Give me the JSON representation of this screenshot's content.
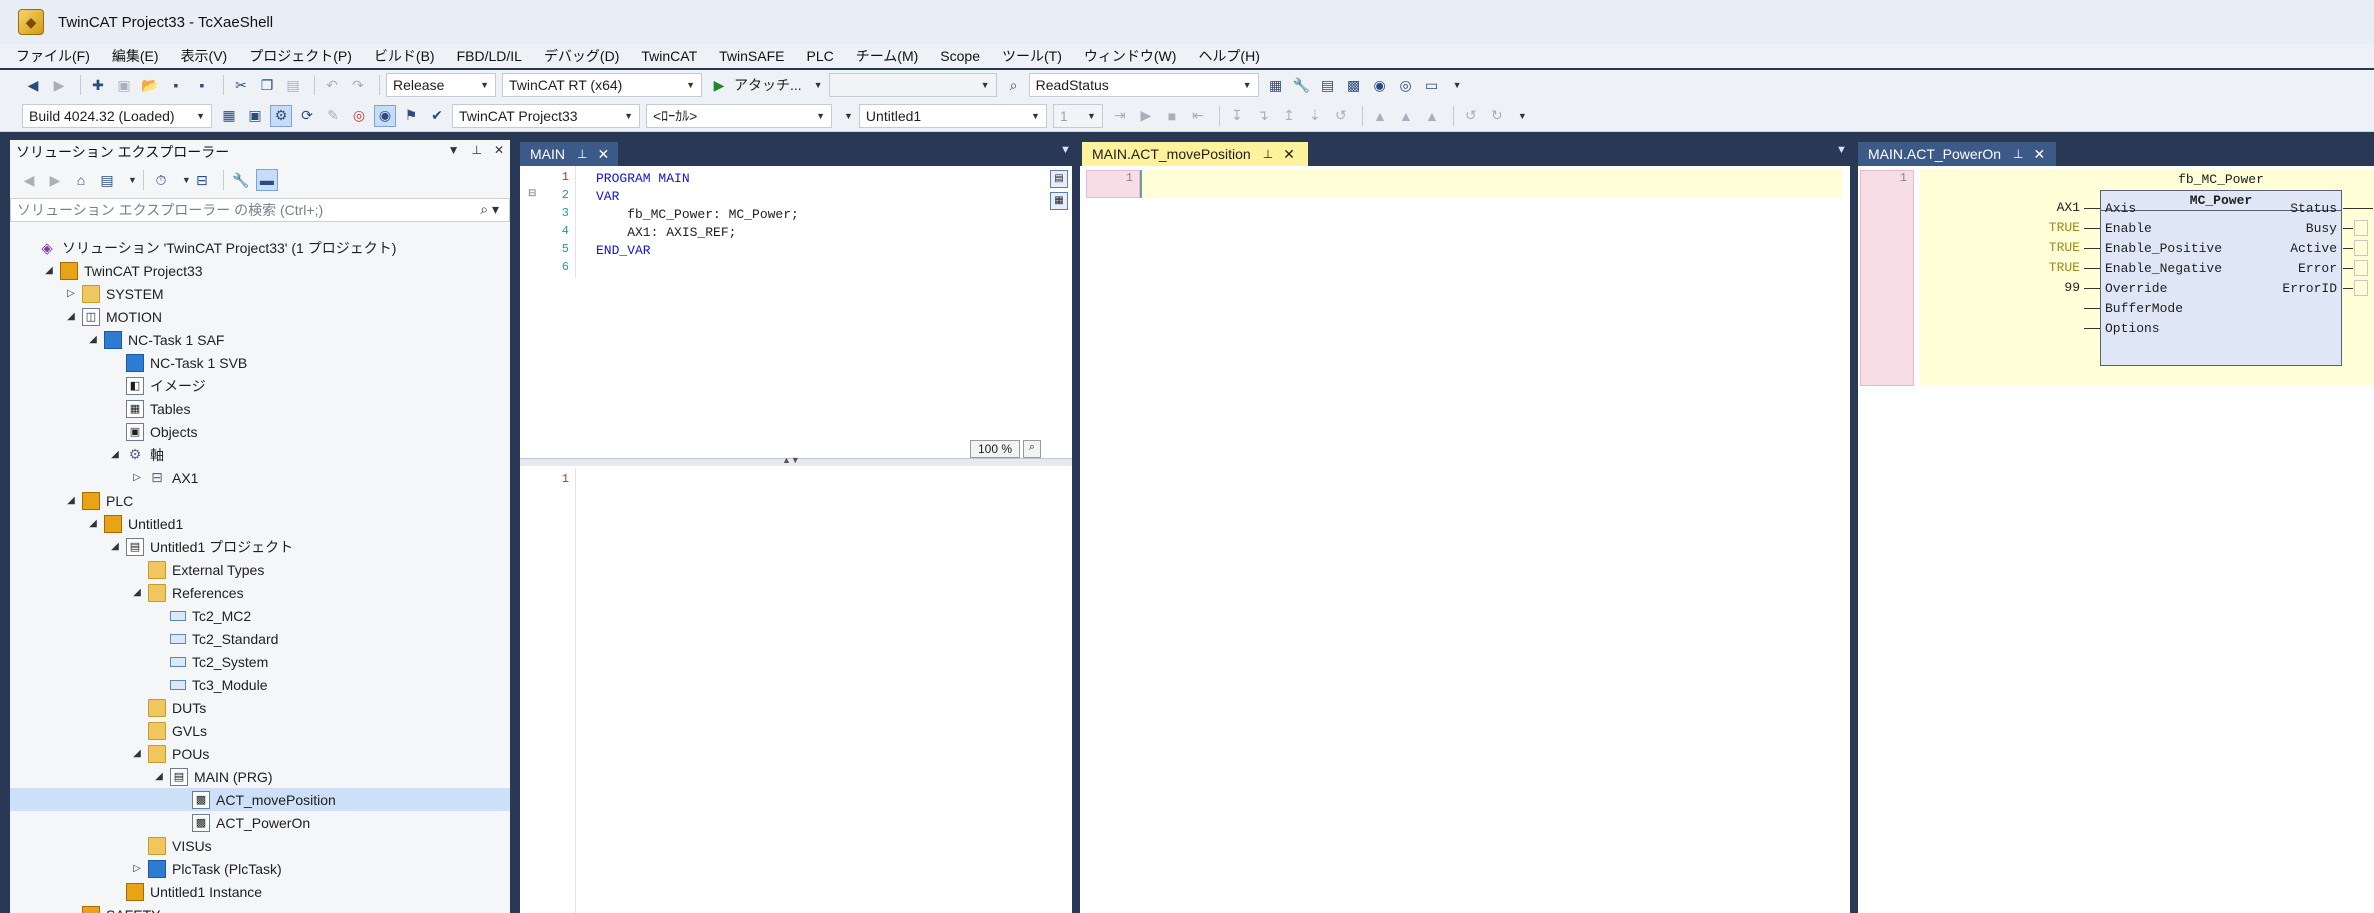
{
  "window": {
    "title": "TwinCAT Project33 - TcXaeShell"
  },
  "menu": [
    "ファイル(F)",
    "編集(E)",
    "表示(V)",
    "プロジェクト(P)",
    "ビルド(B)",
    "FBD/LD/IL",
    "デバッグ(D)",
    "TwinCAT",
    "TwinSAFE",
    "PLC",
    "チーム(M)",
    "Scope",
    "ツール(T)",
    "ウィンドウ(W)",
    "ヘルプ(H)"
  ],
  "toolbar1": {
    "config": "Release",
    "platform": "TwinCAT RT (x64)",
    "attach_label": "アタッチ...",
    "symbol": "ReadStatus"
  },
  "toolbar2": {
    "build": "Build 4024.32 (Loaded)",
    "project": "TwinCAT Project33",
    "target": "<ﾛｰｶﾙ>",
    "plc_project": "Untitled1",
    "task_index": "1"
  },
  "solution_explorer": {
    "title": "ソリューション エクスプローラー",
    "search_placeholder": "ソリューション エクスプローラー の検索 (Ctrl+;)",
    "tree": [
      {
        "label": "ソリューション 'TwinCAT Project33' (1 プロジェクト)",
        "depth": 0,
        "twisty": "",
        "icon": "solution"
      },
      {
        "label": "TwinCAT Project33",
        "depth": 1,
        "twisty": "◢",
        "icon": "project"
      },
      {
        "label": "SYSTEM",
        "depth": 2,
        "twisty": "▷",
        "icon": "system"
      },
      {
        "label": "MOTION",
        "depth": 2,
        "twisty": "◢",
        "icon": "motion"
      },
      {
        "label": "NC-Task 1 SAF",
        "depth": 3,
        "twisty": "◢",
        "icon": "task"
      },
      {
        "label": "NC-Task 1 SVB",
        "depth": 4,
        "twisty": "",
        "icon": "task"
      },
      {
        "label": "イメージ",
        "depth": 4,
        "twisty": "",
        "icon": "image"
      },
      {
        "label": "Tables",
        "depth": 4,
        "twisty": "",
        "icon": "table"
      },
      {
        "label": "Objects",
        "depth": 4,
        "twisty": "",
        "icon": "object"
      },
      {
        "label": "軸",
        "depth": 4,
        "twisty": "◢",
        "icon": "axes"
      },
      {
        "label": "AX1",
        "depth": 5,
        "twisty": "▷",
        "icon": "axis"
      },
      {
        "label": "PLC",
        "depth": 2,
        "twisty": "◢",
        "icon": "plc"
      },
      {
        "label": "Untitled1",
        "depth": 3,
        "twisty": "◢",
        "icon": "plc-project"
      },
      {
        "label": "Untitled1 プロジェクト",
        "depth": 4,
        "twisty": "◢",
        "icon": "project-file"
      },
      {
        "label": "External Types",
        "depth": 5,
        "twisty": "",
        "icon": "folder"
      },
      {
        "label": "References",
        "depth": 5,
        "twisty": "◢",
        "icon": "folder"
      },
      {
        "label": "Tc2_MC2",
        "depth": 6,
        "twisty": "",
        "icon": "reference"
      },
      {
        "label": "Tc2_Standard",
        "depth": 6,
        "twisty": "",
        "icon": "reference"
      },
      {
        "label": "Tc2_System",
        "depth": 6,
        "twisty": "",
        "icon": "reference"
      },
      {
        "label": "Tc3_Module",
        "depth": 6,
        "twisty": "",
        "icon": "reference"
      },
      {
        "label": "DUTs",
        "depth": 5,
        "twisty": "",
        "icon": "folder"
      },
      {
        "label": "GVLs",
        "depth": 5,
        "twisty": "",
        "icon": "folder"
      },
      {
        "label": "POUs",
        "depth": 5,
        "twisty": "◢",
        "icon": "folder"
      },
      {
        "label": "MAIN (PRG)",
        "depth": 6,
        "twisty": "◢",
        "icon": "pou"
      },
      {
        "label": "ACT_movePosition",
        "depth": 7,
        "twisty": "",
        "icon": "action",
        "selected": true
      },
      {
        "label": "ACT_PowerOn",
        "depth": 7,
        "twisty": "",
        "icon": "action"
      },
      {
        "label": "VISUs",
        "depth": 5,
        "twisty": "",
        "icon": "folder"
      },
      {
        "label": "PlcTask (PlcTask)",
        "depth": 5,
        "twisty": "▷",
        "icon": "plc-task"
      },
      {
        "label": "Untitled1 Instance",
        "depth": 4,
        "twisty": "",
        "icon": "instance"
      },
      {
        "label": "SAFETY",
        "depth": 2,
        "twisty": "",
        "icon": "safety"
      }
    ]
  },
  "tabs": {
    "main": "MAIN",
    "move": "MAIN.ACT_movePosition",
    "power": "MAIN.ACT_PowerOn"
  },
  "main_editor": {
    "line_numbers": [
      "1",
      "2",
      "3",
      "4",
      "5",
      "6"
    ],
    "code": [
      {
        "text": "PROGRAM MAIN",
        "kw": true
      },
      {
        "text": "VAR",
        "kw": true
      },
      {
        "text": "    fb_MC_Power: MC_Power;",
        "kw": false
      },
      {
        "text": "    AX1: AXIS_REF;",
        "kw": false
      },
      {
        "text": "END_VAR",
        "kw": true
      },
      {
        "text": "",
        "kw": false
      }
    ],
    "zoom": "100 %",
    "lower_line": "1"
  },
  "move_editor": {
    "line": "1"
  },
  "power_editor": {
    "line": "1",
    "instance": "fb_MC_Power",
    "type": "MC_Power",
    "inputs": [
      {
        "pin": "Axis",
        "value": "AX1",
        "bool": false
      },
      {
        "pin": "Enable",
        "value": "TRUE",
        "bool": true
      },
      {
        "pin": "Enable_Positive",
        "value": "TRUE",
        "bool": true
      },
      {
        "pin": "Enable_Negative",
        "value": "TRUE",
        "bool": true
      },
      {
        "pin": "Override",
        "value": "99",
        "bool": false
      },
      {
        "pin": "BufferMode",
        "value": "",
        "bool": false
      },
      {
        "pin": "Options",
        "value": "",
        "bool": false
      }
    ],
    "outputs": [
      "Status",
      "Busy",
      "Active",
      "Error",
      "ErrorID"
    ]
  }
}
